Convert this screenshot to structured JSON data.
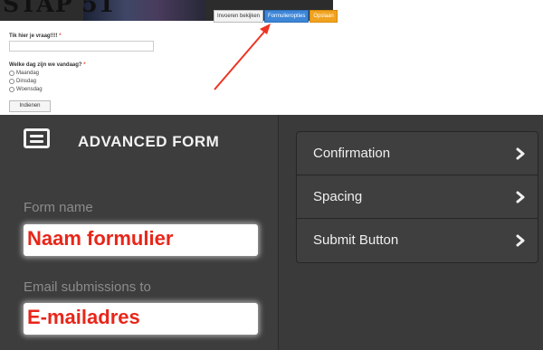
{
  "heading": "STAP 51",
  "preview": {
    "tabs": [
      "Invoeren bekijken",
      "Formulieropties",
      "Opslaan"
    ],
    "question1": {
      "label": "Tik hier je vraag!!!!",
      "required": "*"
    },
    "question2": {
      "label": "Welke dag zijn we vandaag?",
      "required": "*"
    },
    "options": [
      "Maandag",
      "Dinsdag",
      "Woensdag"
    ],
    "submit": "Indienen"
  },
  "panel": {
    "title": "ADVANCED FORM",
    "form_name_label": "Form name",
    "form_name_value": "Naam formulier",
    "email_label": "Email submissions to",
    "email_value": "E-mailadres",
    "menu": [
      "Confirmation",
      "Spacing",
      "Submit Button"
    ]
  },
  "colors": {
    "annotation_red": "#e8261a",
    "active_tab": "#3d86d8",
    "save_tab": "#f1a31f",
    "panel_bg": "#3d3d3d"
  }
}
